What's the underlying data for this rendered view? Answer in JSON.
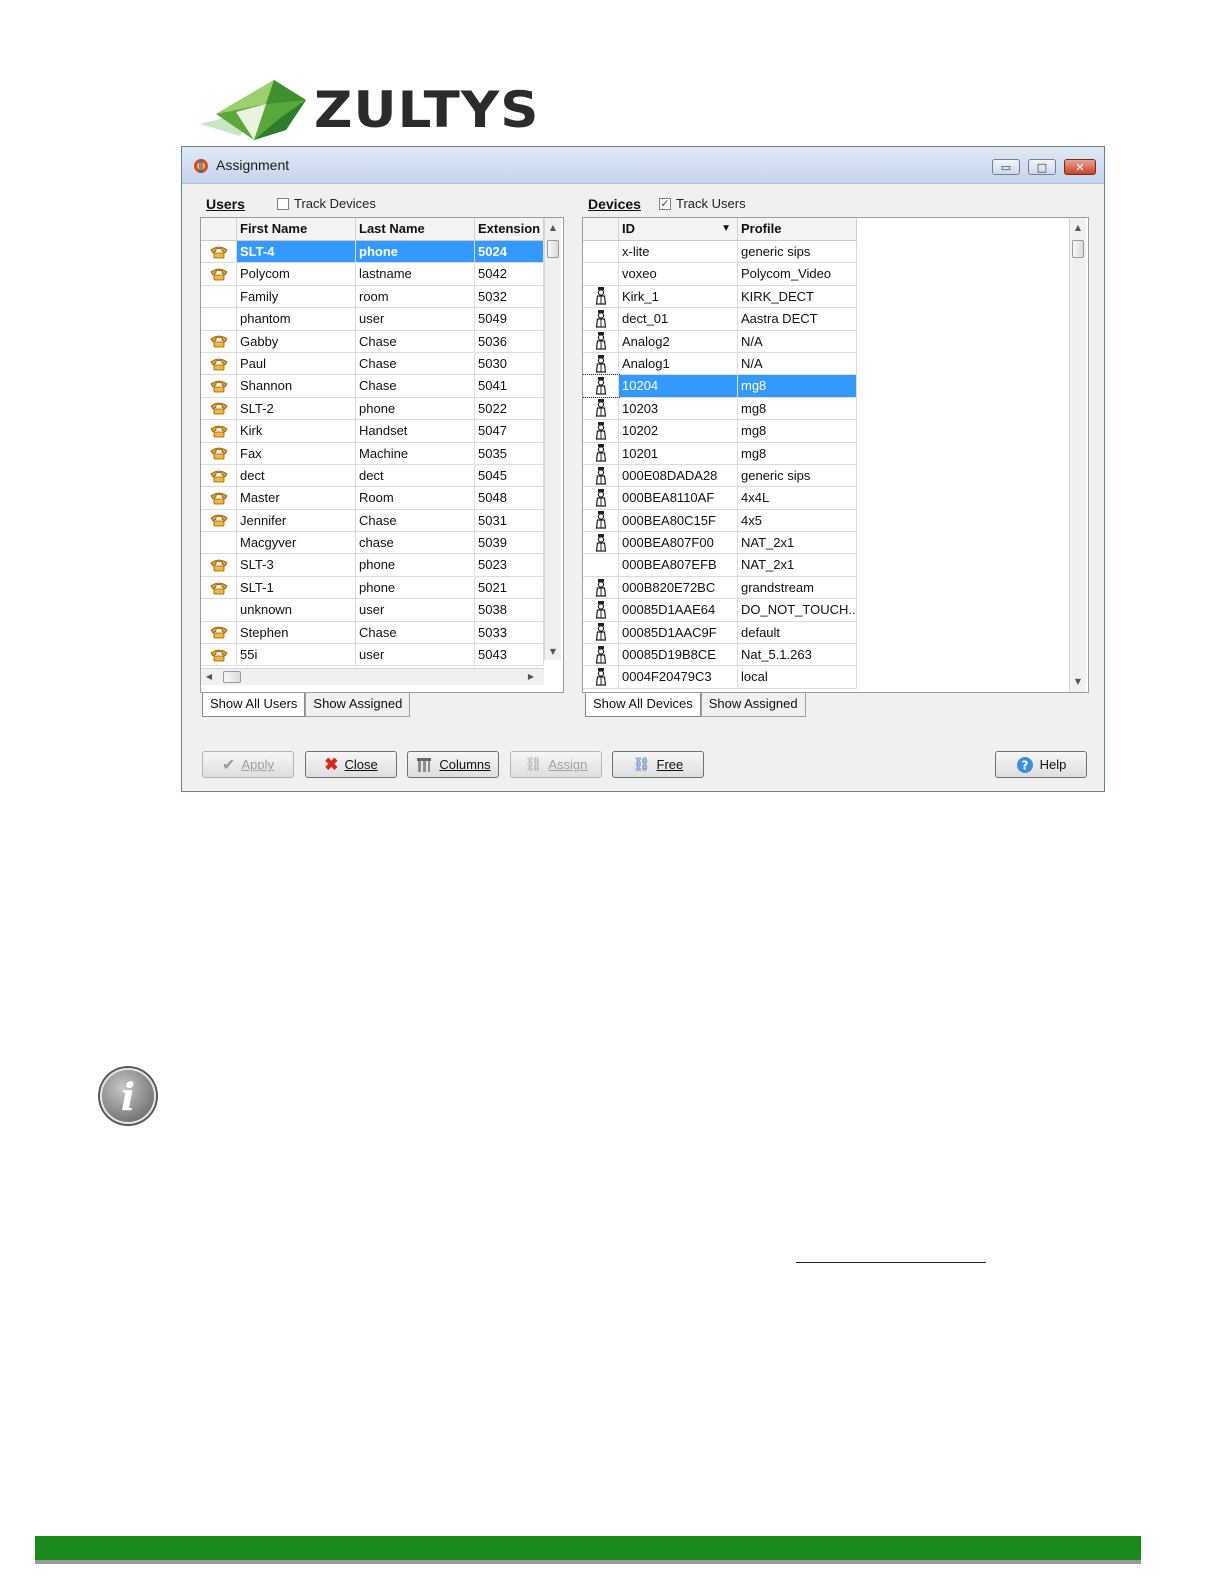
{
  "logo": {
    "brand": "ZULTYS"
  },
  "window": {
    "title": "Assignment",
    "controls": {
      "minimize": "▭",
      "maximize": "□",
      "close": "✕"
    }
  },
  "users": {
    "label": "Users",
    "track_label": "Track Devices",
    "track_checked": false,
    "columns": [
      "First Name",
      "Last Name",
      "Extension"
    ],
    "rows": [
      {
        "icon": "phone-icon",
        "first": "SLT-4",
        "last": "phone",
        "ext": "5024",
        "selected": true
      },
      {
        "icon": "phone-icon",
        "first": "Polycom",
        "last": "lastname",
        "ext": "5042"
      },
      {
        "icon": "",
        "first": "Family",
        "last": "room",
        "ext": "5032"
      },
      {
        "icon": "",
        "first": "phantom",
        "last": "user",
        "ext": "5049"
      },
      {
        "icon": "phone-icon",
        "first": "Gabby",
        "last": "Chase",
        "ext": "5036"
      },
      {
        "icon": "phone-icon",
        "first": "Paul",
        "last": "Chase",
        "ext": "5030"
      },
      {
        "icon": "phone-icon",
        "first": "Shannon",
        "last": "Chase",
        "ext": "5041"
      },
      {
        "icon": "phone-icon",
        "first": "SLT-2",
        "last": "phone",
        "ext": "5022"
      },
      {
        "icon": "phone-icon",
        "first": "Kirk",
        "last": "Handset",
        "ext": "5047"
      },
      {
        "icon": "phone-icon",
        "first": "Fax",
        "last": "Machine",
        "ext": "5035"
      },
      {
        "icon": "phone-icon",
        "first": "dect",
        "last": "dect",
        "ext": "5045"
      },
      {
        "icon": "phone-icon",
        "first": "Master",
        "last": "Room",
        "ext": "5048"
      },
      {
        "icon": "phone-icon",
        "first": "Jennifer",
        "last": "Chase",
        "ext": "5031"
      },
      {
        "icon": "",
        "first": "Macgyver",
        "last": "chase",
        "ext": "5039"
      },
      {
        "icon": "phone-icon",
        "first": "SLT-3",
        "last": "phone",
        "ext": "5023"
      },
      {
        "icon": "phone-icon",
        "first": "SLT-1",
        "last": "phone",
        "ext": "5021"
      },
      {
        "icon": "",
        "first": "unknown",
        "last": "user",
        "ext": "5038"
      },
      {
        "icon": "phone-icon",
        "first": "Stephen",
        "last": "Chase",
        "ext": "5033"
      },
      {
        "icon": "phone-icon",
        "first": "55i",
        "last": "user",
        "ext": "5043"
      }
    ],
    "tabs": [
      "Show All Users",
      "Show Assigned"
    ]
  },
  "devices": {
    "label": "Devices",
    "track_label": "Track Users",
    "track_checked": true,
    "columns": [
      "ID",
      "Profile"
    ],
    "rows": [
      {
        "icon": "",
        "id": "x-lite",
        "profile": "generic sips"
      },
      {
        "icon": "",
        "id": "voxeo",
        "profile": "Polycom_Video"
      },
      {
        "icon": "person-icon",
        "id": "Kirk_1",
        "profile": "KIRK_DECT"
      },
      {
        "icon": "person-icon",
        "id": "dect_01",
        "profile": "Aastra DECT"
      },
      {
        "icon": "person-icon",
        "id": "Analog2",
        "profile": "N/A"
      },
      {
        "icon": "person-icon",
        "id": "Analog1",
        "profile": "N/A"
      },
      {
        "icon": "person-icon",
        "id": "10204",
        "profile": "mg8",
        "selected": true
      },
      {
        "icon": "person-icon",
        "id": "10203",
        "profile": "mg8"
      },
      {
        "icon": "person-icon",
        "id": "10202",
        "profile": "mg8"
      },
      {
        "icon": "person-icon",
        "id": "10201",
        "profile": "mg8"
      },
      {
        "icon": "person-icon",
        "id": "000E08DADA28",
        "profile": "generic sips"
      },
      {
        "icon": "person-icon",
        "id": "000BEA8110AF",
        "profile": "4x4L"
      },
      {
        "icon": "person-icon",
        "id": "000BEA80C15F",
        "profile": "4x5"
      },
      {
        "icon": "person-icon",
        "id": "000BEA807F00",
        "profile": "NAT_2x1"
      },
      {
        "icon": "",
        "id": "000BEA807EFB",
        "profile": "NAT_2x1"
      },
      {
        "icon": "person-icon",
        "id": "000B820E72BC",
        "profile": "grandstream"
      },
      {
        "icon": "person-icon",
        "id": "00085D1AAE64",
        "profile": "DO_NOT_TOUCH..."
      },
      {
        "icon": "person-icon",
        "id": "00085D1AAC9F",
        "profile": "default"
      },
      {
        "icon": "person-icon",
        "id": "00085D19B8CE",
        "profile": "Nat_5.1.263"
      },
      {
        "icon": "person-icon",
        "id": "0004F20479C3",
        "profile": "local"
      }
    ],
    "tabs": [
      "Show All Devices",
      "Show Assigned"
    ]
  },
  "buttons": {
    "apply": "Apply",
    "close": "Close",
    "columns": "Columns",
    "assign": "Assign",
    "free": "Free",
    "help": "Help"
  },
  "colors": {
    "selection": "#3399ff",
    "footer": "#1b8a1b",
    "titlebar": "#c4d5ea"
  }
}
